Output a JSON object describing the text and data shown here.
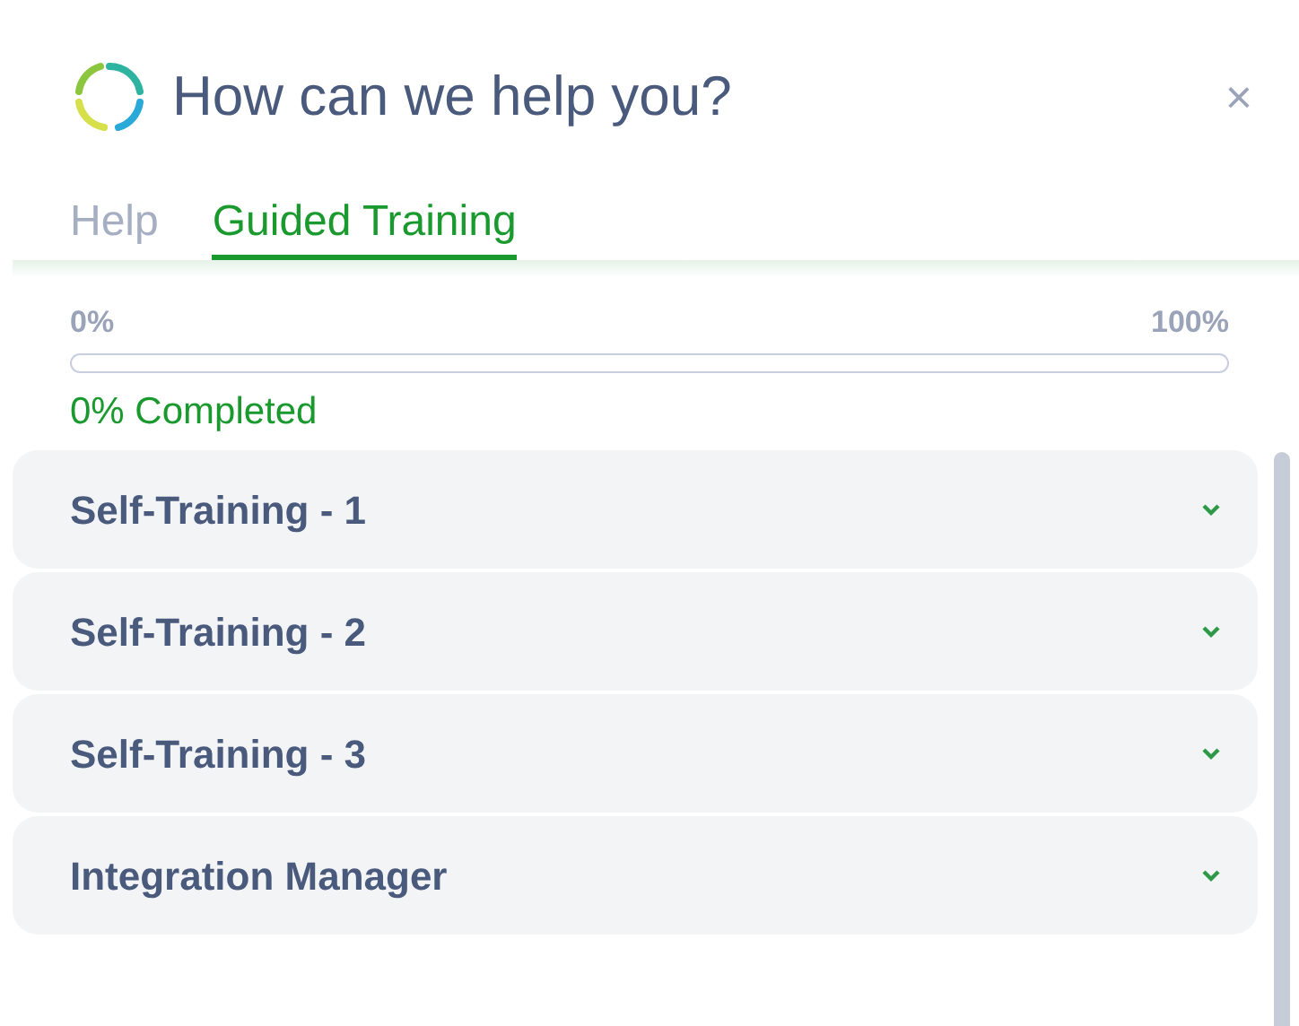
{
  "header": {
    "title": "How can we help you?",
    "close": "×"
  },
  "tabs": [
    {
      "label": "Help",
      "selected": false
    },
    {
      "label": "Guided Training",
      "selected": true
    }
  ],
  "progress": {
    "min_label": "0%",
    "max_label": "100%",
    "level": 0,
    "status": "0% Completed"
  },
  "sections": [
    {
      "title": "Self-Training - 1",
      "expanded": false
    },
    {
      "title": "Self-Training - 2",
      "expanded": false
    },
    {
      "title": "Self-Training - 3",
      "expanded": false
    },
    {
      "title": "Integration Manager",
      "expanded": false
    }
  ]
}
